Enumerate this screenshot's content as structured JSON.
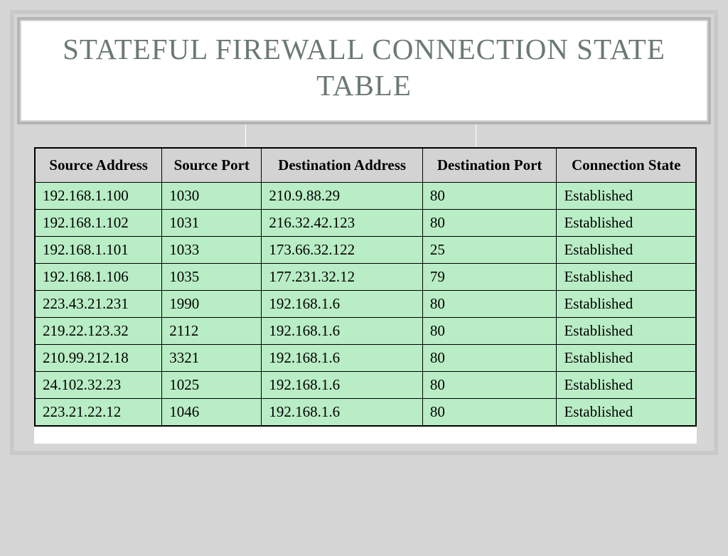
{
  "title": "STATEFUL FIREWALL CONNECTION STATE TABLE",
  "table": {
    "headers": [
      "Source Address",
      "Source Port",
      "Destination Address",
      "Destination Port",
      "Connection State"
    ],
    "rows": [
      [
        "192.168.1.100",
        "1030",
        "210.9.88.29",
        "80",
        "Established"
      ],
      [
        "192.168.1.102",
        "1031",
        "216.32.42.123",
        "80",
        "Established"
      ],
      [
        "192.168.1.101",
        "1033",
        "173.66.32.122",
        "25",
        "Established"
      ],
      [
        "192.168.1.106",
        "1035",
        "177.231.32.12",
        "79",
        "Established"
      ],
      [
        "223.43.21.231",
        "1990",
        "192.168.1.6",
        "80",
        "Established"
      ],
      [
        "219.22.123.32",
        "2112",
        "192.168.1.6",
        "80",
        "Established"
      ],
      [
        "210.99.212.18",
        "3321",
        "192.168.1.6",
        "80",
        "Established"
      ],
      [
        "24.102.32.23",
        "1025",
        "192.168.1.6",
        "80",
        "Established"
      ],
      [
        "223.21.22.12",
        "1046",
        "192.168.1.6",
        "80",
        "Established"
      ]
    ]
  }
}
